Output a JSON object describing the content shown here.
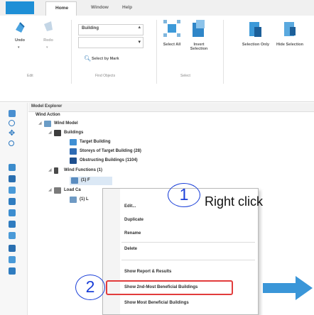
{
  "ribbon": {
    "tabs": {
      "home": "Home",
      "window": "Window",
      "help": "Help"
    },
    "buttons": {
      "undo": "Undo",
      "redo": "Redo",
      "select_by_mark": "Select by Mark",
      "select_all": "Select All",
      "invert_selection": "Invert Selection",
      "selection_only": "Selection Only",
      "hide_selection": "Hide Selection"
    },
    "find_combo_value": "Building",
    "groups": {
      "edit": "Edit",
      "find": "Find Objects",
      "select": "Select"
    }
  },
  "explorer": {
    "title": "Model Explorer",
    "tree": {
      "root": "Wind Action",
      "wind_model": "Wind Model",
      "buildings": "Buildings",
      "target_building": "Target Building",
      "storeys": "Storeys of Target Building (28)",
      "obstructing": "Obstructing Buildings (1104)",
      "wind_functions": "Wind Functions (1)",
      "wf_child": "(1) F",
      "load_cases": "Load Ca",
      "lc_child": "(1) L"
    }
  },
  "context_menu": {
    "items": [
      "Edit...",
      "Duplicate",
      "Rename",
      "Delete",
      "Show Report & Results",
      "Show 2nd-Most Beneficial Buildings",
      "Show Most Beneficial Buildings"
    ]
  },
  "annotations": {
    "step1": "1",
    "step1_label": "Right click",
    "step2": "2"
  },
  "colors": {
    "accent_blue": "#1e8fd6",
    "annotation_blue": "#1a3fd8",
    "highlight_red": "#e23c3c",
    "arrow_blue": "#3a96d8"
  }
}
